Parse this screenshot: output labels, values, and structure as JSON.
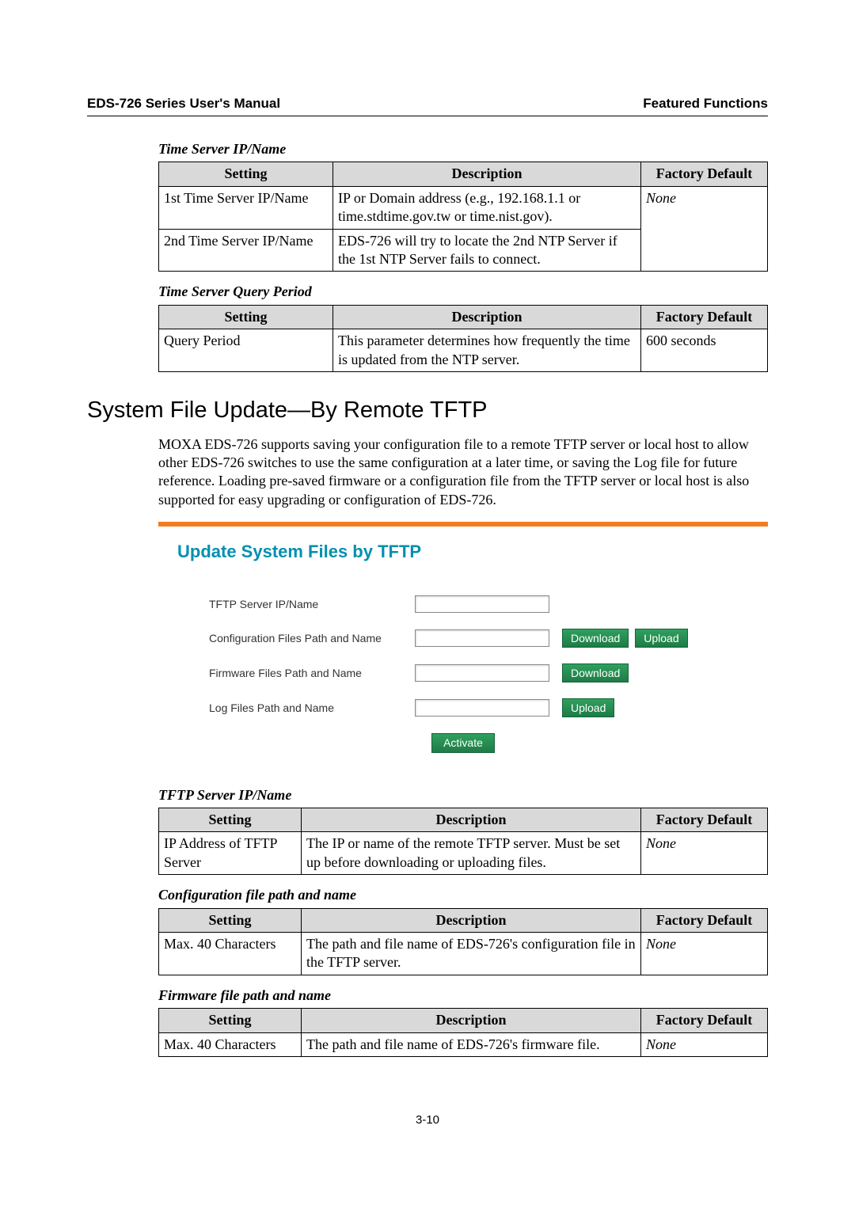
{
  "header": {
    "left": "EDS-726 Series User's Manual",
    "right": "Featured Functions"
  },
  "tables": {
    "t1": {
      "caption": "Time Server IP/Name",
      "hdr": {
        "c1": "Setting",
        "c2": "Description",
        "c3": "Factory Default"
      },
      "r1": {
        "c1": "1st Time Server IP/Name",
        "c2": "IP or Domain address (e.g., 192.168.1.1 or time.stdtime.gov.tw or time.nist.gov)."
      },
      "r2": {
        "c1": "2nd Time Server IP/Name",
        "c2": "EDS-726 will try to locate the 2nd NTP Server if the 1st NTP Server fails to connect."
      },
      "fd": "None"
    },
    "t2": {
      "caption": "Time Server Query Period",
      "hdr": {
        "c1": "Setting",
        "c2": "Description",
        "c3": "Factory Default"
      },
      "r1": {
        "c1": "Query Period",
        "c2": "This parameter determines how frequently the time is updated from the NTP server.",
        "c3": "600 seconds"
      }
    },
    "t3": {
      "caption": "TFTP Server IP/Name",
      "hdr": {
        "c1": "Setting",
        "c2": "Description",
        "c3": "Factory Default"
      },
      "r1": {
        "c1": "IP Address of TFTP Server",
        "c2": "The IP or name of the remote TFTP server. Must be set up before downloading or uploading files.",
        "c3": "None"
      }
    },
    "t4": {
      "caption": "Configuration file path and name",
      "hdr": {
        "c1": "Setting",
        "c2": "Description",
        "c3": "Factory Default"
      },
      "r1": {
        "c1": "Max. 40 Characters",
        "c2": "The path and file name of EDS-726's configuration file in the TFTP server.",
        "c3": "None"
      }
    },
    "t5": {
      "caption": "Firmware file path and name",
      "hdr": {
        "c1": "Setting",
        "c2": "Description",
        "c3": "Factory Default"
      },
      "r1": {
        "c1": "Max. 40 Characters",
        "c2": "The path and file name of EDS-726's firmware file.",
        "c3": "None"
      }
    }
  },
  "section": {
    "title": "System File Update—By Remote TFTP",
    "body": "MOXA EDS-726 supports saving your configuration file to a remote TFTP server or local host to allow other EDS-726 switches to use the same configuration at a later time, or saving the Log file for future reference. Loading pre-saved firmware or a configuration file from the TFTP server or local host is also supported for easy upgrading or configuration of EDS-726."
  },
  "tftp": {
    "title": "Update System Files by TFTP",
    "rows": {
      "r1": {
        "label": "TFTP Server IP/Name"
      },
      "r2": {
        "label": "Configuration Files Path and Name",
        "b1": "Download",
        "b2": "Upload"
      },
      "r3": {
        "label": "Firmware Files Path and Name",
        "b1": "Download"
      },
      "r4": {
        "label": "Log Files Path and Name",
        "b1": "Upload"
      }
    },
    "activate": "Activate"
  },
  "page": "3-10"
}
